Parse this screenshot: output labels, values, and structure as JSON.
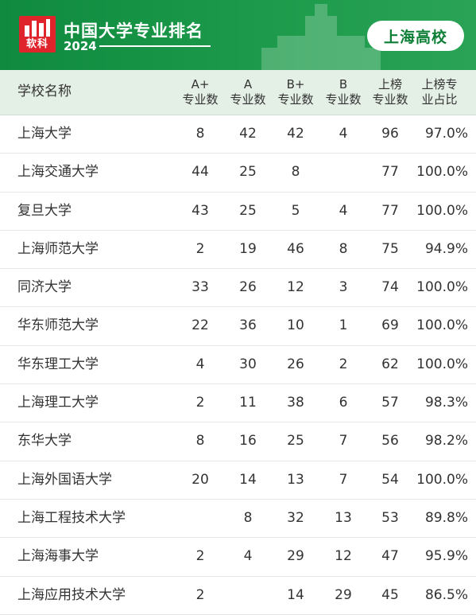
{
  "banner": {
    "logo_text": "软科",
    "title": "中国大学专业排名",
    "year": "2024",
    "region": "上海高校"
  },
  "table": {
    "headers": [
      [
        "学校名称"
      ],
      [
        "A+",
        "专业数"
      ],
      [
        "A",
        "专业数"
      ],
      [
        "B+",
        "专业数"
      ],
      [
        "B",
        "专业数"
      ],
      [
        "上榜",
        "专业数"
      ],
      [
        "上榜专",
        "业占比"
      ]
    ],
    "rows": [
      [
        "上海大学",
        "8",
        "42",
        "42",
        "4",
        "96",
        "97.0%"
      ],
      [
        "上海交通大学",
        "44",
        "25",
        "8",
        "",
        "77",
        "100.0%"
      ],
      [
        "复旦大学",
        "43",
        "25",
        "5",
        "4",
        "77",
        "100.0%"
      ],
      [
        "上海师范大学",
        "2",
        "19",
        "46",
        "8",
        "75",
        "94.9%"
      ],
      [
        "同济大学",
        "33",
        "26",
        "12",
        "3",
        "74",
        "100.0%"
      ],
      [
        "华东师范大学",
        "22",
        "36",
        "10",
        "1",
        "69",
        "100.0%"
      ],
      [
        "华东理工大学",
        "4",
        "30",
        "26",
        "2",
        "62",
        "100.0%"
      ],
      [
        "上海理工大学",
        "2",
        "11",
        "38",
        "6",
        "57",
        "98.3%"
      ],
      [
        "东华大学",
        "8",
        "16",
        "25",
        "7",
        "56",
        "98.2%"
      ],
      [
        "上海外国语大学",
        "20",
        "14",
        "13",
        "7",
        "54",
        "100.0%"
      ],
      [
        "上海工程技术大学",
        "",
        "8",
        "32",
        "13",
        "53",
        "89.8%"
      ],
      [
        "上海海事大学",
        "2",
        "4",
        "29",
        "12",
        "47",
        "95.9%"
      ],
      [
        "上海应用技术大学",
        "2",
        "",
        "14",
        "29",
        "45",
        "86.5%"
      ]
    ]
  },
  "colors": {
    "banner_green": "#1d9a4b",
    "header_bg": "#e4efe6",
    "logo_red": "#e0242b",
    "badge_text": "#0d7f37"
  }
}
